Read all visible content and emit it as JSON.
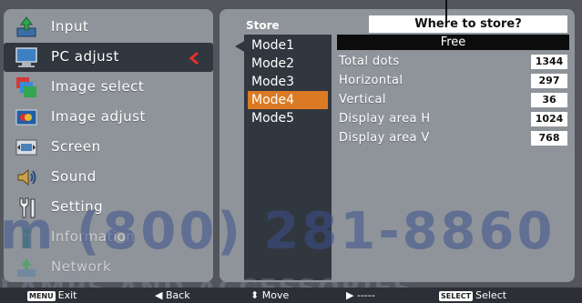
{
  "menu": {
    "items": [
      {
        "label": "Input",
        "icon": "input-icon",
        "selected": false,
        "faded": false
      },
      {
        "label": "PC adjust",
        "icon": "pc-adjust-icon",
        "selected": true,
        "faded": false
      },
      {
        "label": "Image select",
        "icon": "image-select-icon",
        "selected": false,
        "faded": false
      },
      {
        "label": "Image adjust",
        "icon": "image-adjust-icon",
        "selected": false,
        "faded": false
      },
      {
        "label": "Screen",
        "icon": "screen-icon",
        "selected": false,
        "faded": false
      },
      {
        "label": "Sound",
        "icon": "sound-icon",
        "selected": false,
        "faded": false
      },
      {
        "label": "Setting",
        "icon": "setting-icon",
        "selected": false,
        "faded": false
      },
      {
        "label": "Information",
        "icon": "information-icon",
        "selected": false,
        "faded": true
      },
      {
        "label": "Network",
        "icon": "network-icon",
        "selected": false,
        "faded": true
      }
    ]
  },
  "store": {
    "title": "Store",
    "callout": "Where to store?",
    "modes": [
      "Mode1",
      "Mode2",
      "Mode3",
      "Mode4",
      "Mode5"
    ],
    "selected_mode": "Mode4",
    "free_label": "Free"
  },
  "params": [
    {
      "label": "Total dots",
      "value": "1344"
    },
    {
      "label": "Horizontal",
      "value": "297"
    },
    {
      "label": "Vertical",
      "value": "36"
    },
    {
      "label": "Display area H",
      "value": "1024"
    },
    {
      "label": "Display area V",
      "value": "768"
    }
  ],
  "footer": {
    "exit_key": "MENU",
    "exit_label": "Exit",
    "back_label": "Back",
    "move_label": "Move",
    "next_label": "-----",
    "select_key": "SELECT",
    "select_label": "Select"
  },
  "watermark": {
    "phone": "m (800) 281-8860",
    "text": "LAMPS AND ACCESSORIES"
  },
  "colors": {
    "selected_mode_bg": "#dc7a23",
    "selected_arrow": "#e0312b",
    "panel_bg": "#8f949a",
    "dark_bg": "#31373f"
  }
}
